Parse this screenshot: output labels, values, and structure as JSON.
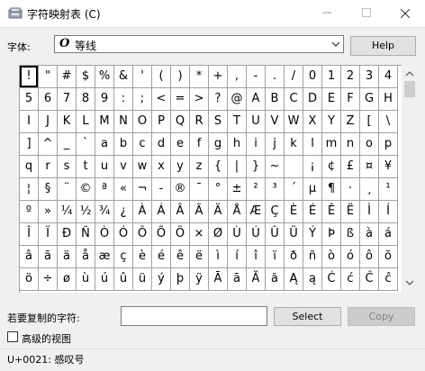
{
  "window": {
    "title": "字符映射表 (C)"
  },
  "font": {
    "label": "字体:",
    "name": "等线",
    "glyph": "O"
  },
  "help_label": "Help",
  "grid": {
    "chars": [
      "!",
      "\"",
      "#",
      "$",
      "%",
      "&",
      "'",
      "(",
      ")",
      "*",
      "+",
      ",",
      "-",
      ".",
      "/",
      "0",
      "1",
      "2",
      "3",
      "4",
      "5",
      "6",
      "7",
      "8",
      "9",
      ":",
      ";",
      "<",
      "=",
      ">",
      "?",
      "@",
      "A",
      "B",
      "C",
      "D",
      "E",
      "F",
      "G",
      "H",
      "I",
      "J",
      "K",
      "L",
      "M",
      "N",
      "O",
      "P",
      "Q",
      "R",
      "S",
      "T",
      "U",
      "V",
      "W",
      "X",
      "Y",
      "Z",
      "[",
      "\\",
      "]",
      "^",
      "_",
      "`",
      "a",
      "b",
      "c",
      "d",
      "e",
      "f",
      "g",
      "h",
      "i",
      "j",
      "k",
      "l",
      "m",
      "n",
      "o",
      "p",
      "q",
      "r",
      "s",
      "t",
      "u",
      "v",
      "w",
      "x",
      "y",
      "z",
      "{",
      "|",
      "}",
      "~",
      " ",
      "¡",
      "¢",
      "£",
      "¤",
      "¥",
      "¦",
      "§",
      "¨",
      "©",
      "ª",
      "«",
      "¬",
      "-",
      "®",
      "¯",
      "°",
      "±",
      "²",
      "³",
      "´",
      "µ",
      "¶",
      "·",
      "¸",
      "¹",
      "º",
      "»",
      "¼",
      "½",
      "¾",
      "¿",
      "À",
      "Á",
      "Â",
      "Ã",
      "Ä",
      "Å",
      "Æ",
      "Ç",
      "È",
      "É",
      "Ê",
      "Ë",
      "Ì",
      "Í",
      "Î",
      "Ï",
      "Ð",
      "Ñ",
      "Ò",
      "Ó",
      "Ô",
      "Õ",
      "Ö",
      "×",
      "Ø",
      "Ù",
      "Ú",
      "Û",
      "Ü",
      "Ý",
      "Þ",
      "ß",
      "à",
      "á",
      "â",
      "ã",
      "ä",
      "å",
      "æ",
      "ç",
      "è",
      "é",
      "ê",
      "ë",
      "ì",
      "í",
      "î",
      "ï",
      "ð",
      "ñ",
      "ò",
      "ó",
      "ô",
      "õ",
      "ö",
      "÷",
      "ø",
      "ù",
      "ú",
      "û",
      "ü",
      "ý",
      "þ",
      "ÿ",
      "Ā",
      "ā",
      "Ă",
      "ă",
      "Ą",
      "ą",
      "Ć",
      "ć",
      "Ĉ",
      "ĉ"
    ],
    "selected_index": 0
  },
  "copy": {
    "label": "若要复制的字符:",
    "value": "",
    "select_label": "Select",
    "copy_label": "Copy"
  },
  "advanced": {
    "label": "高级的视图",
    "checked": false
  },
  "status": {
    "text": "U+0021: 感叹号"
  },
  "colors": {
    "window_bg": "#f0f0f0",
    "grid_line": "#a0a0a0",
    "button_bg": "#e1e1e1",
    "disabled_text": "#838383"
  }
}
